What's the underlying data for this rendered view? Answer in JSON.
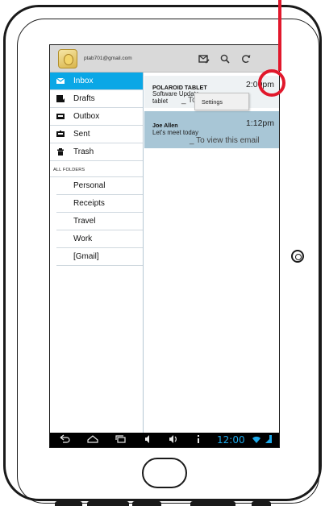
{
  "header": {
    "account": "ptab701@gmail.com",
    "icons": [
      "compose-icon",
      "search-icon",
      "refresh-icon"
    ]
  },
  "drawer": {
    "items": [
      {
        "label": "Inbox",
        "icon": "inbox-icon",
        "selected": true
      },
      {
        "label": "Drafts",
        "icon": "drafts-icon"
      },
      {
        "label": "Outbox",
        "icon": "outbox-icon"
      },
      {
        "label": "Sent",
        "icon": "sent-icon"
      },
      {
        "label": "Trash",
        "icon": "trash-icon"
      }
    ],
    "section_header": "ALL FOLDERS",
    "folders": [
      "Personal",
      "Receipts",
      "Travel",
      "Work",
      "[Gmail]"
    ]
  },
  "messages": [
    {
      "sender": "POLAROID TABLET",
      "time": "2:00pm",
      "subject": "Software Update",
      "line2": "tablet",
      "snippet": "_ To v"
    },
    {
      "sender": "Joe Allen",
      "time": "1:12pm",
      "subject": "Let's meet today",
      "snippet": "_ To view this email"
    }
  ],
  "overflow_menu": {
    "items": [
      "Settings"
    ]
  },
  "system_bar": {
    "clock": "12:00",
    "icons": [
      "back-icon",
      "home-icon",
      "recent-apps-icon",
      "volume-down-icon",
      "volume-up-icon",
      "menu-icon",
      "wifi-icon",
      "battery-icon"
    ]
  },
  "colors": {
    "selected": "#0aa7e6",
    "callout": "#e1182c",
    "selected_message": "#a8c6d6",
    "clock": "#1da9ea"
  }
}
